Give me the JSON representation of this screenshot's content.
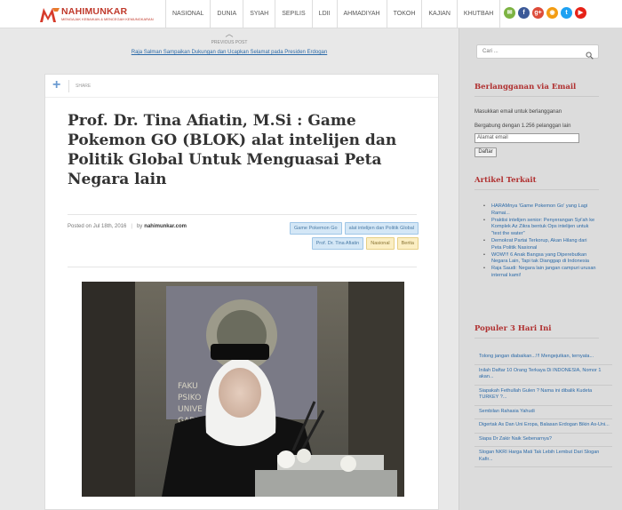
{
  "header": {
    "logo_name": "NAHIMUNKAR",
    "logo_tagline": "MENGAJAK KEBAIKAN & MENCEGAH KEMUNGKARAN",
    "nav": [
      "NASIONAL",
      "DUNIA",
      "SYIAH",
      "SEPILIS",
      "LDII",
      "AHMADIYAH",
      "TOKOH",
      "KAJIAN",
      "KHUTBAH"
    ],
    "social": [
      {
        "icon": "email-icon",
        "color": "#7cb342",
        "glyph": "✉"
      },
      {
        "icon": "facebook-icon",
        "color": "#3b5998",
        "glyph": "f"
      },
      {
        "icon": "google-plus-icon",
        "color": "#dd4b39",
        "glyph": "g+"
      },
      {
        "icon": "rss-icon",
        "color": "#f39c12",
        "glyph": "◉"
      },
      {
        "icon": "twitter-icon",
        "color": "#1da1f2",
        "glyph": "t"
      },
      {
        "icon": "youtube-icon",
        "color": "#e62117",
        "glyph": "▶"
      }
    ]
  },
  "prev_post": {
    "label": "PREVIOUS POST",
    "title": "Raja Salman Sampaikan Dukungan dan Ucapkan Selamat pada Presiden Erdogan"
  },
  "article": {
    "share_label": "SHARE",
    "title": "Prof. Dr. Tina Afiatin, M.Si : Game Pokemon GO (BLOK) alat intelijen dan Politik Global Untuk Menguasai Peta Negara lain",
    "posted": "Posted on Jul 18th, 2016",
    "by": "by",
    "author": "nahimunkar.com",
    "tags": [
      "Game Pokemon Go",
      "alat intelijen dan Politik Global",
      "Prof. Dr. Tina Afiatin"
    ],
    "categories": [
      "Nasional",
      "Berita"
    ]
  },
  "sidebar": {
    "search_placeholder": "Cari ...",
    "subscribe_title": "Berlangganan via Email",
    "subscribe_text1": "Masukkan email untuk berlangganan",
    "subscribe_text2": "Bergabung dengan 1.256 pelanggan lain",
    "email_placeholder": "Alamat email",
    "subscribe_button": "Daftar",
    "related_title": "Artikel Terkait",
    "related": [
      "HARAMnya 'Game Pokemon Go' yang Lagi Ramai...",
      "Praktisi intelijen senior: Penyerangan Syi'ah ke Komplek Az Zikra bentuk Ops intelijen untuk \"test the water\"",
      "Demokrat Partai Terkorup, Akan Hilang dari Peta Politik Nasional",
      "WOW!!! 6 Anak Bangsa yang Diperebutkan Negara Lain, Tapi tak Dianggap di Indonesia",
      "Raja Saudi: Negara lain jangan campuri urusan internal kami!"
    ],
    "popular_title": "Populer 3 Hari Ini",
    "popular": [
      "Tolong jangan diabaikan...!!! Mengejutkan, ternyata...",
      "Inilah Daftar 10 Orang Terkaya Di INDONESIA, Nomor 1 akan...",
      "Siapakah Fethullah Gulen ? Nama ini dibalik Kudeta TURKEY ?...",
      "Sembilan Rahasia Yahudi",
      "Digertak As Dan Uni Eropa, Balasan Erdogan Bikin As-Uni...",
      "Siapa Dr Zakir Naik Sebenarnya?",
      "Slogan NKRI Harga Mati Tak Lebih Lembut Dari Slogan Kafir..."
    ]
  }
}
